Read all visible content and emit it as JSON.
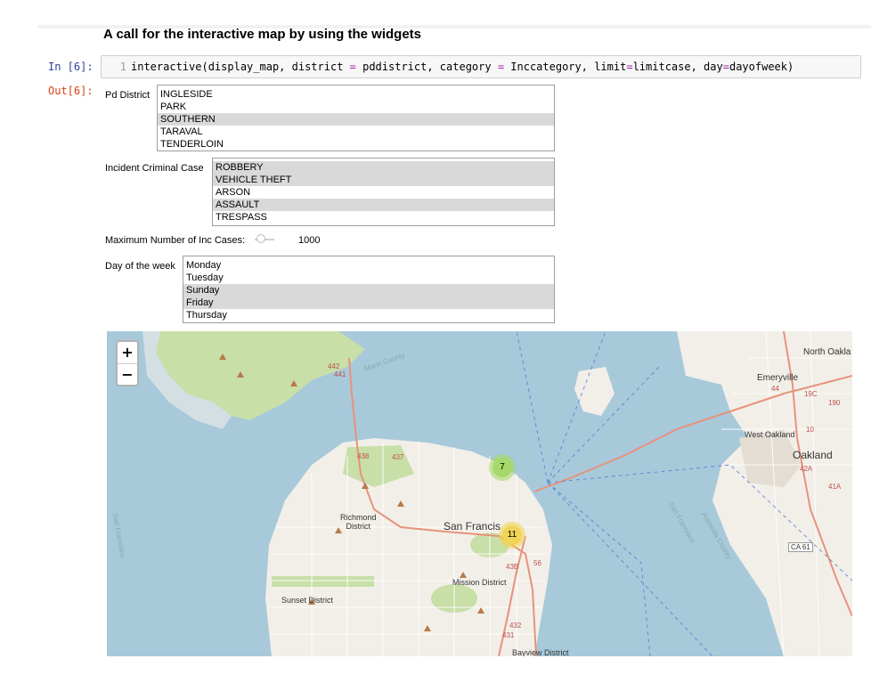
{
  "heading": "A call for the interactive map by using the widgets",
  "cell": {
    "in_prompt": "In [6]:",
    "out_prompt": "Out[6]:",
    "line_number": "1",
    "code_tokens": [
      {
        "t": "interactive(display_map, district ",
        "c": "txt"
      },
      {
        "t": "=",
        "c": "op"
      },
      {
        "t": " pddistrict, category ",
        "c": "txt"
      },
      {
        "t": "=",
        "c": "op"
      },
      {
        "t": " Inccategory, limit",
        "c": "txt"
      },
      {
        "t": "=",
        "c": "op"
      },
      {
        "t": "limitcase, day",
        "c": "txt"
      },
      {
        "t": "=",
        "c": "op"
      },
      {
        "t": "dayofweek)",
        "c": "txt"
      }
    ]
  },
  "widgets": {
    "district": {
      "label": "Pd District",
      "options": [
        {
          "text": "INGLESIDE",
          "selected": false
        },
        {
          "text": "PARK",
          "selected": false
        },
        {
          "text": "SOUTHERN",
          "selected": true
        },
        {
          "text": "TARAVAL",
          "selected": false
        },
        {
          "text": "TENDERLOIN",
          "selected": false
        }
      ]
    },
    "category": {
      "label": "Incident Criminal Case",
      "options": [
        {
          "text": "ROBBERY",
          "selected": true
        },
        {
          "text": "VEHICLE THEFT",
          "selected": true
        },
        {
          "text": "ARSON",
          "selected": false
        },
        {
          "text": "ASSAULT",
          "selected": true
        },
        {
          "text": "TRESPASS",
          "selected": false
        }
      ]
    },
    "limit": {
      "label": "Maximum Number of Inc Cases:",
      "value": "1000"
    },
    "day": {
      "label": "Day of the week",
      "options": [
        {
          "text": "Monday",
          "selected": false
        },
        {
          "text": "Tuesday",
          "selected": false
        },
        {
          "text": "Sunday",
          "selected": true
        },
        {
          "text": "Friday",
          "selected": true
        },
        {
          "text": "Thursday",
          "selected": false
        }
      ]
    }
  },
  "map": {
    "zoom_in": "+",
    "zoom_out": "−",
    "labels": {
      "north_oakland": "North Oakla",
      "emeryville": "Emeryville",
      "west_oakland": "West Oakland",
      "oakland": "Oakland",
      "richmond": "Richmond\nDistrict",
      "san_francisco": "San Francis",
      "mission": "Mission District",
      "sunset": "Sunset District",
      "bayview": "Bayview District",
      "marin": "Marin County",
      "sf_side": "San Francisco",
      "alameda": "Alameda County",
      "sf_bay": "San Francisco",
      "ca61": "CA 61",
      "r442": "442",
      "r441": "441",
      "r438": "438",
      "r437": "437",
      "r43b": "43B",
      "r56": "56",
      "r432": "432",
      "r431": "431",
      "r44": "44",
      "r42a": "42A",
      "r41a": "41A",
      "r190": "190",
      "r19c": "19C",
      "r10": "10"
    },
    "clusters": [
      {
        "count": "7",
        "color": "#a6d96a"
      },
      {
        "count": "11",
        "color": "#f1d357"
      }
    ],
    "colors": {
      "water": "#a7c9da",
      "land": "#f2efe9",
      "park": "#c8dfa8"
    }
  }
}
